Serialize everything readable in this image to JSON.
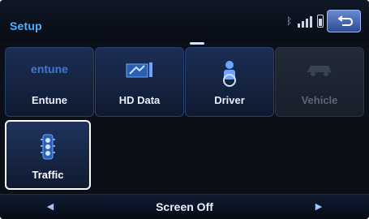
{
  "header": {
    "title": "Setup",
    "status_icons": [
      "bluetooth-icon",
      "signal-icon",
      "battery-icon"
    ],
    "back_icon": "return-arrow-icon"
  },
  "menu": {
    "items": [
      {
        "label": "Entune",
        "icon": "entune-logo-icon",
        "enabled": true
      },
      {
        "label": "HD Data",
        "icon": "hd-data-icon",
        "enabled": true
      },
      {
        "label": "Driver",
        "icon": "driver-icon",
        "enabled": true
      },
      {
        "label": "Vehicle",
        "icon": "vehicle-icon",
        "enabled": false
      },
      {
        "label": "Traffic",
        "icon": "traffic-light-icon",
        "enabled": true,
        "selected": true
      }
    ]
  },
  "bottom_bar": {
    "left_icon": "left-arrow-icon",
    "label": "Screen Off",
    "right_icon": "right-arrow-icon"
  },
  "colors": {
    "accent_blue": "#4fb1ff",
    "background": "#0a0f18",
    "selection": "#ffffff"
  }
}
